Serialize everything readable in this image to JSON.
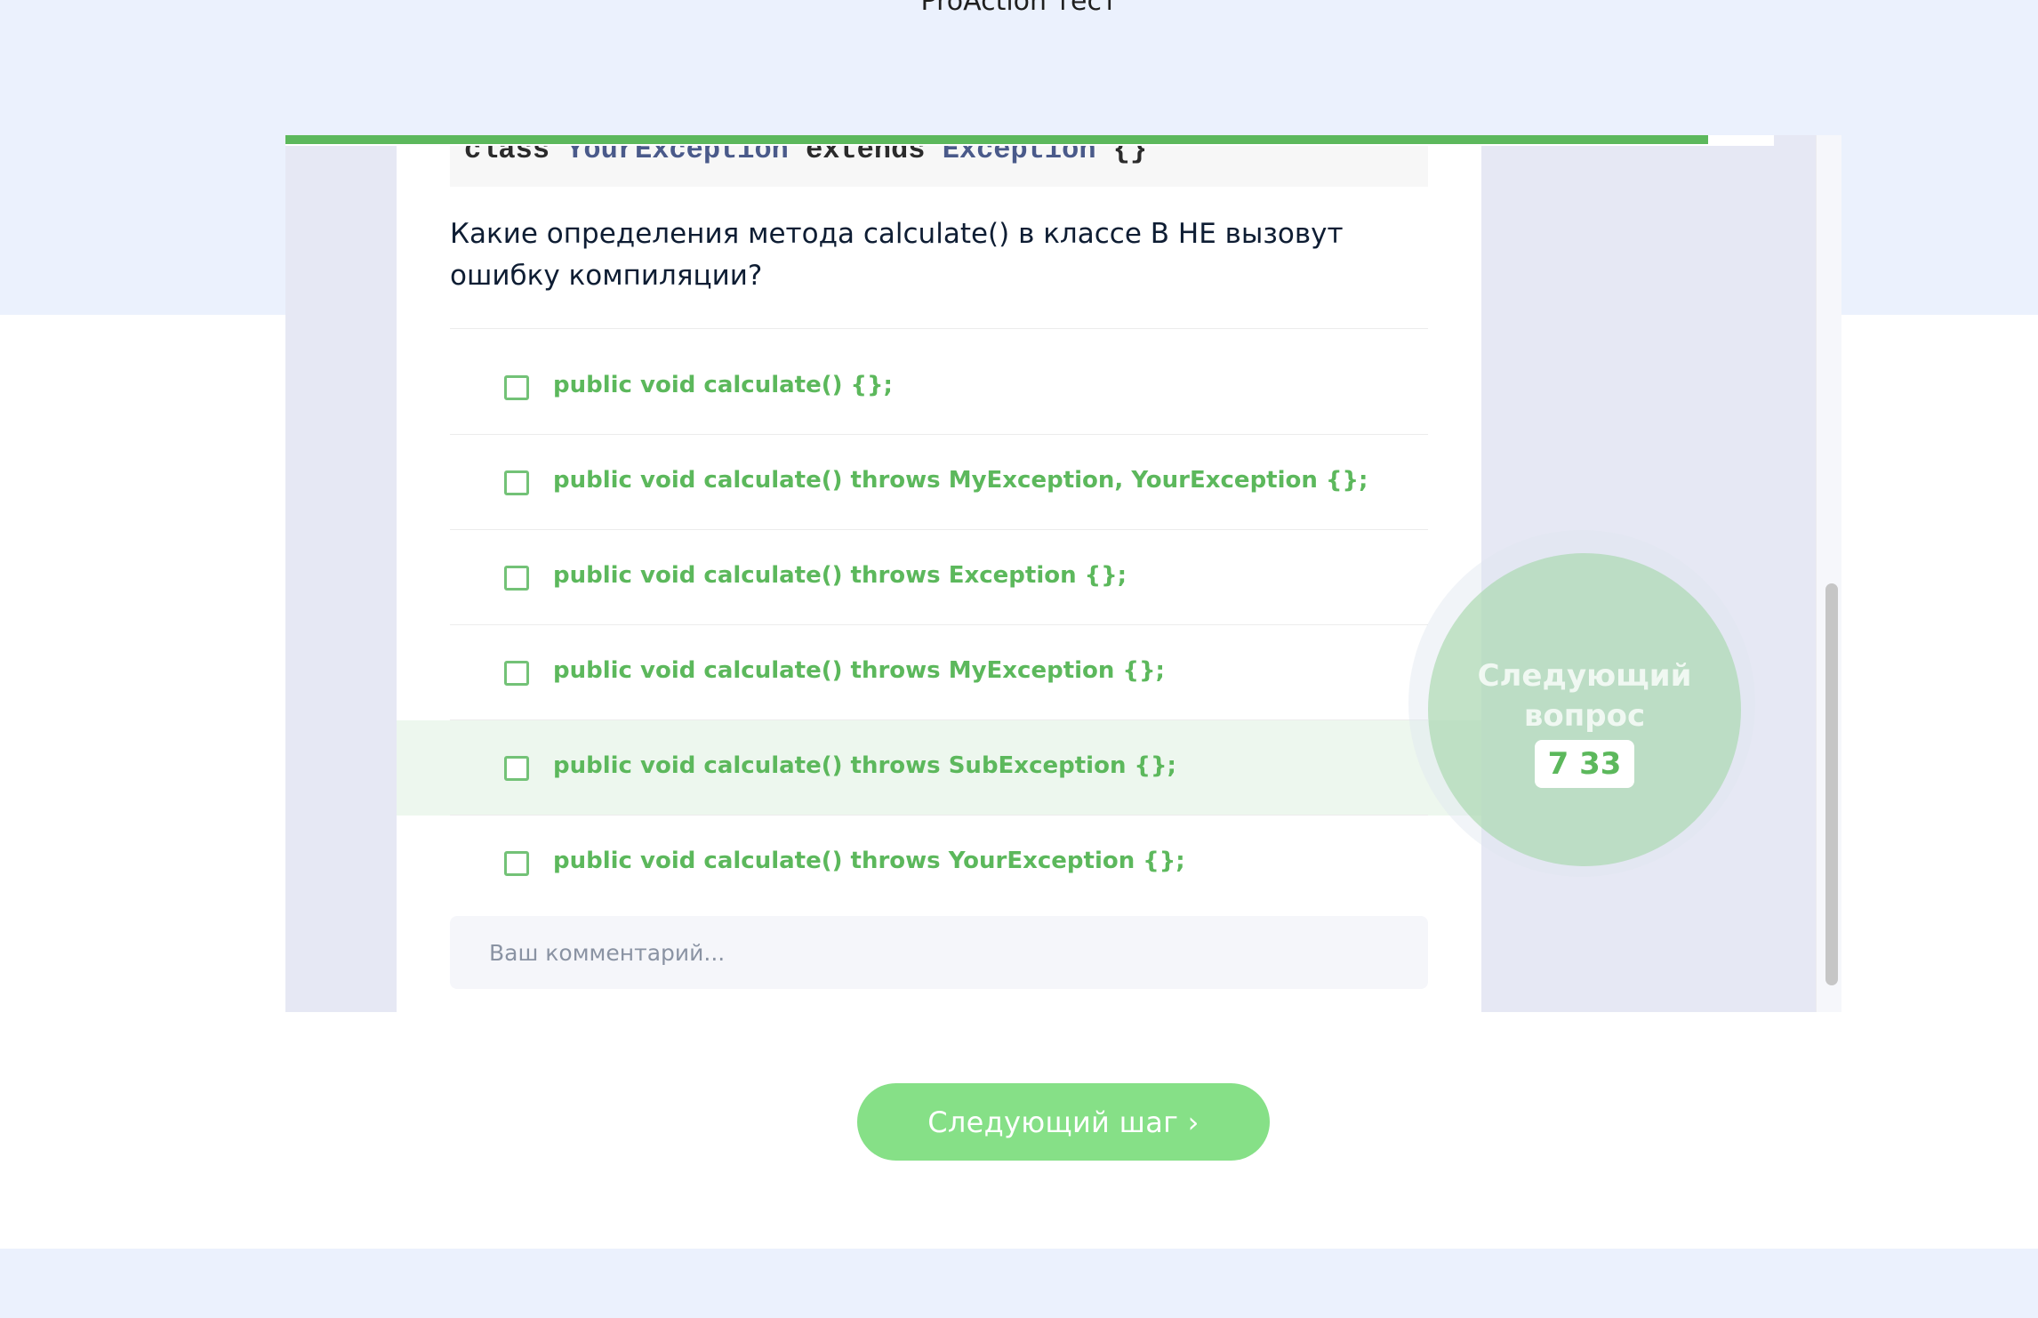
{
  "app": {
    "title": "ProAction тест"
  },
  "colors": {
    "accent": "#5cb85c",
    "button": "#86e087",
    "background_band": "#ebf1fd"
  },
  "progress": {
    "fraction": 0.956
  },
  "code": {
    "kw_class": "class",
    "type_1": "YourException",
    "kw_extends": "extends",
    "type_2": "Exception",
    "braces": "{}"
  },
  "question": {
    "text": "Какие определения метода calculate() в классе B НЕ вызовут ошибку компиляции?"
  },
  "options": [
    {
      "label": "public void calculate() {};"
    },
    {
      "label": "public void calculate() throws MyException, YourException {};"
    },
    {
      "label": "public void calculate() throws Exception {};"
    },
    {
      "label": "public void calculate() throws MyException {};"
    },
    {
      "label": "public void calculate() throws SubException {};"
    },
    {
      "label": "public void calculate() throws YourException {};"
    }
  ],
  "comment": {
    "placeholder": "Ваш комментарий..."
  },
  "timer": {
    "label": "Следующий вопрос",
    "count": "7 33"
  },
  "next_button": {
    "label": "Следующий шаг ›"
  }
}
